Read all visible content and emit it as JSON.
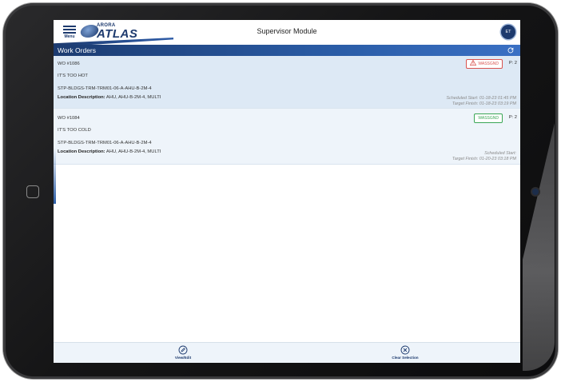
{
  "header": {
    "menu_label": "Menu",
    "logo_top": "ARORA",
    "logo_main": "ATLAS",
    "title": "Supervisor Module",
    "avatar_initials": "ET"
  },
  "section": {
    "title": "Work Orders",
    "refresh_icon": "refresh-icon"
  },
  "work_orders": [
    {
      "number": "WO #1086",
      "description": "IT'S TOO HOT",
      "asset": "STP-BLDGS-TRM-TRM01-06-A-AHU-B-2M-4",
      "location_label": "Location Description:",
      "location_value": "AHU, AHU-B-2M-4, MULTI",
      "status": "WASSGND",
      "status_icon": "warning-icon",
      "priority": "P: 2",
      "scheduled_start": "Scheduled Start: 01-18-23 01:45 PM",
      "target_finish": "Target Finish: 01-18-23 03:19 PM",
      "selected": true
    },
    {
      "number": "WO #1084",
      "description": "IT'S TOO COLD",
      "asset": "STP-BLDGS-TRM-TRM01-06-A-AHU-B-2M-4",
      "location_label": "Location Description:",
      "location_value": "AHU, AHU-B-2M-4, MULTI",
      "status": "WASSGND",
      "priority": "P: 2",
      "scheduled_start": "Scheduled Start:",
      "target_finish": "Target Finish: 01-20-23 03:18 PM",
      "selected": false
    }
  ],
  "footer": {
    "view_edit": "View/Edit",
    "clear_selection": "Clear Selection"
  },
  "colors": {
    "brand_navy": "#1d3a6e",
    "brand_blue": "#2a5ca6",
    "selected_row": "#dde9f5",
    "warn": "#d9534f",
    "ok": "#3aa655"
  }
}
